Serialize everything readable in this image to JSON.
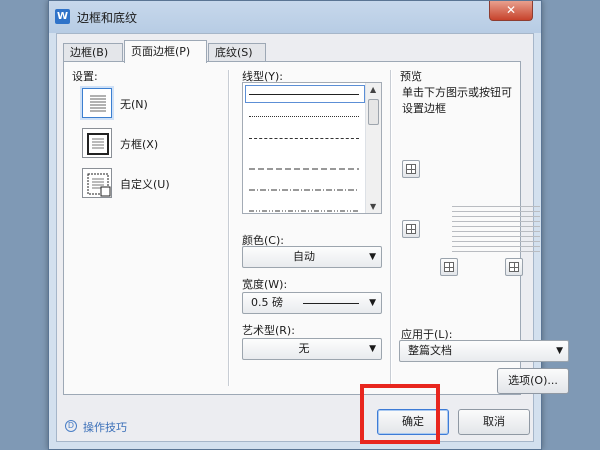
{
  "window": {
    "title": "边框和底纹",
    "close_glyph": "✕"
  },
  "tabs": [
    {
      "label": "边框(B)"
    },
    {
      "label": "页面边框(P)"
    },
    {
      "label": "底纹(S)"
    }
  ],
  "settings": {
    "label": "设置:",
    "items": [
      {
        "label": "无(N)"
      },
      {
        "label": "方框(X)"
      },
      {
        "label": "自定义(U)"
      }
    ]
  },
  "line_style": {
    "label": "线型(Y):"
  },
  "color": {
    "label": "颜色(C):",
    "value": "自动"
  },
  "width": {
    "label": "宽度(W):",
    "value": "0.5  磅"
  },
  "art": {
    "label": "艺术型(R):",
    "value": "无"
  },
  "preview": {
    "label": "预览",
    "hint": "单击下方图示或按钮可设置边框"
  },
  "apply_to": {
    "label": "应用于(L):",
    "value": "整篇文档"
  },
  "buttons": {
    "options": "选项(O)...",
    "ok": "确定",
    "cancel": "取消"
  },
  "help": {
    "label": "操作技巧",
    "icon_glyph": "D"
  },
  "accent_color": "#e8261e"
}
